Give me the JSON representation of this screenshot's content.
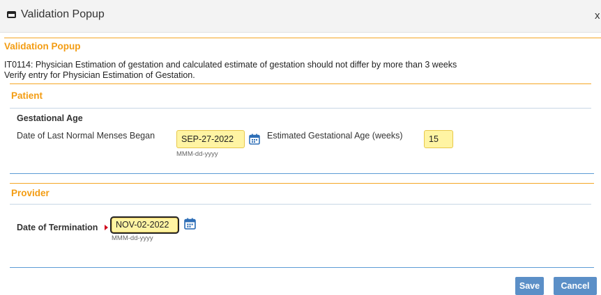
{
  "window": {
    "title": "Validation Popup",
    "close_glyph": "x",
    "window_icon": "window-icon"
  },
  "popup": {
    "header": "Validation Popup",
    "message_line1": "IT0114: Physician Estimation of gestation and calculated estimate of gestation should not differ by more than 3 weeks",
    "message_line2": "Verify entry for Physician Estimation of Gestation."
  },
  "patient": {
    "header": "Patient",
    "subsection": "Gestational Age",
    "lmp_label": "Date of Last Normal Menses Began",
    "lmp_value": "SEP-27-2022",
    "lmp_hint": "MMM-dd-yyyy",
    "ega_label": "Estimated Gestational Age (weeks)",
    "ega_value": "15"
  },
  "provider": {
    "header": "Provider",
    "termination_label": "Date of Termination",
    "termination_value": "NOV-02-2022",
    "termination_hint": "MMM-dd-yyyy"
  },
  "buttons": {
    "save": "Save",
    "cancel": "Cancel"
  },
  "colors": {
    "section_header": "#f39c12",
    "input_highlight": "#fff4a3",
    "button": "#5b8fc7",
    "divider_blue": "#5b9bd5",
    "divider_orange": "#f5a623"
  }
}
